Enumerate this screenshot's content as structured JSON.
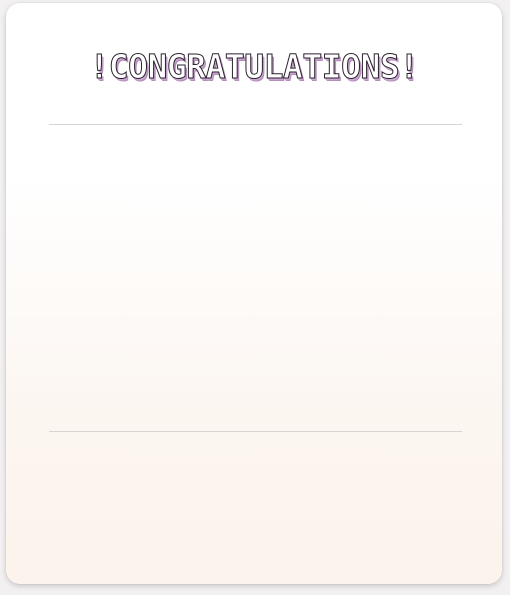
{
  "dialog": {
    "title": "!CONGRATULATIONS!"
  }
}
